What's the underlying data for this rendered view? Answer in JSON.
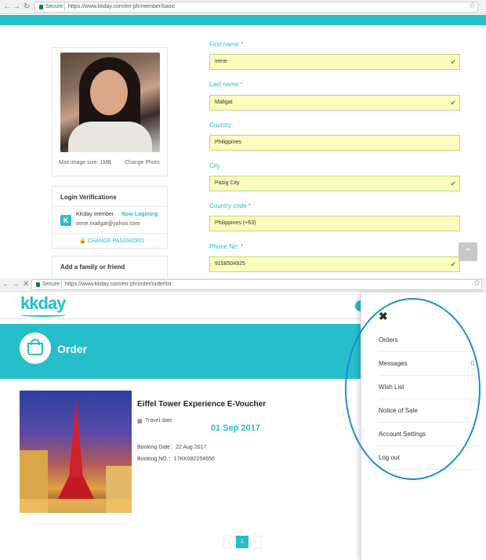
{
  "browser_top": {
    "secure": "Secure",
    "url": "https://www.kkday.com/en-ph/member/basic"
  },
  "browser_bottom": {
    "secure": "Secure",
    "url": "https://www.kkday.com/en-ph/order/orderlist"
  },
  "profile": {
    "max_image_size": "Max image size: 1MB",
    "change_photo": "Change Photo"
  },
  "login_verifications": {
    "title": "Login Verifications",
    "provider": "KKday member",
    "status": "Now Logining",
    "email": "irene.maligat@yahoo.com",
    "change_password": "CHANGE PASSWORD"
  },
  "add_family": {
    "title": "Add a family or friend"
  },
  "form": {
    "first_name_label": "First name *",
    "first_name": "Irene",
    "last_name_label": "Last name *",
    "last_name": "Maligat",
    "country_label": "Country",
    "country": "Philippines",
    "city_label": "City",
    "city": "Pasig City",
    "country_code_label": "Country code *",
    "country_code": "Philippines (+63)",
    "phone_label": "Phone No. *",
    "phone": "9158504925"
  },
  "logo": "kkday",
  "order": {
    "title": "Order",
    "item_title": "Eiffel Tower Experience E-Voucher",
    "travel_date_label": "Travel date",
    "travel_date": "01 Sep 2017",
    "booking_date": "Booking Date：22 Aug 2017",
    "booking_no": "Booking NO.：17KK082254656",
    "page": "1"
  },
  "menu": {
    "orders": "Orders",
    "messages": "Messages",
    "messages_count": "0",
    "wish_list": "Wish List",
    "notice_of_sale": "Notice of Sale",
    "account_settings": "Account Settings",
    "log_out": "Log out"
  },
  "colors": {
    "accent": "#26bec9",
    "field_bg": "#fbfdbd",
    "annotation": "#1a8fd1"
  }
}
